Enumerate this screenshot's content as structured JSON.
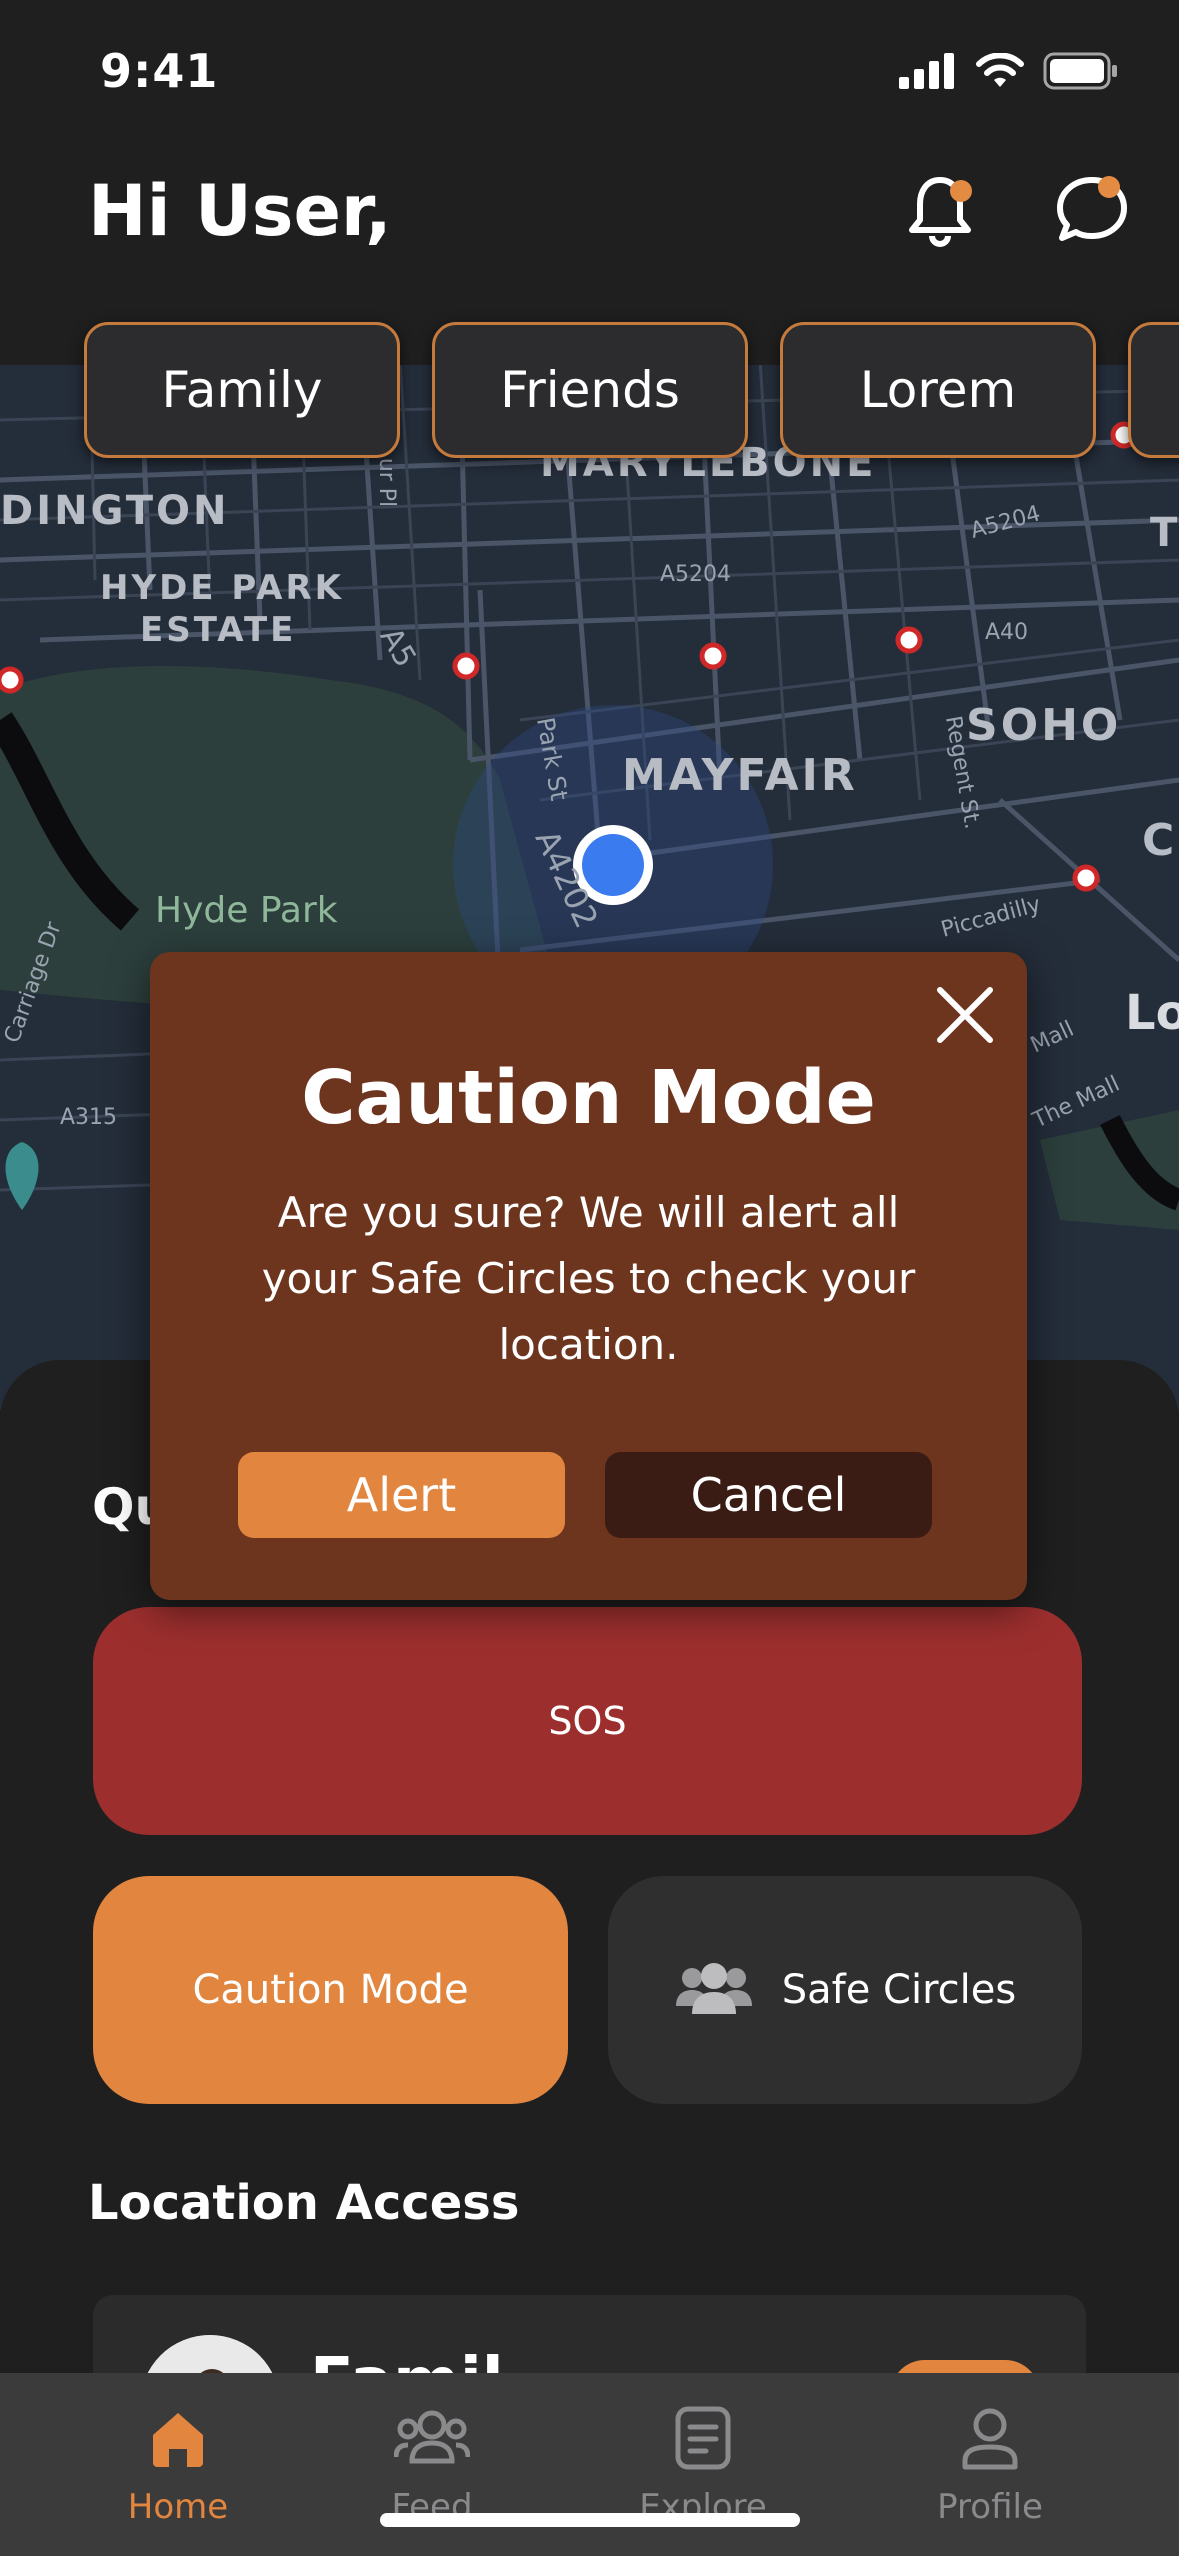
{
  "status_bar": {
    "time": "9:41"
  },
  "header": {
    "greeting": "Hi User,"
  },
  "chips": [
    "Family",
    "Friends",
    "Lorem"
  ],
  "map": {
    "labels": {
      "marylebone": "MARYLEBONE",
      "dington": "DINGTON",
      "hyde_park_estate_1": "HYDE PARK",
      "hyde_park_estate_2": "ESTATE",
      "mayfair": "MAYFAIR",
      "soho": "SOHO",
      "hyde_park": "Hyde Park",
      "a5204_1": "A5204",
      "a5204_2": "A5204",
      "a40": "A40",
      "a5": "A5",
      "park_st": "Park St",
      "a4202": "A4202",
      "regent_st": "Regent St.",
      "piccadilly": "Piccadilly",
      "carriage_dr": "Carriage Dr",
      "a315": "A315",
      "the_mall": "The Mall",
      "mall": "Mall",
      "lo": "Lo",
      "c": "C",
      "t": "T",
      "pl": "ur Pl"
    }
  },
  "quick_actions": {
    "title": "Qu",
    "sos_label": "SOS",
    "caution_label": "Caution Mode",
    "circles_label": "Safe Circles"
  },
  "location_access": {
    "title": "Location Access",
    "card_title": "Famil"
  },
  "tabs": [
    {
      "label": "Home"
    },
    {
      "label": "Feed"
    },
    {
      "label": "Explore"
    },
    {
      "label": "Profile"
    }
  ],
  "modal": {
    "title": "Caution Mode",
    "body": "Are you sure? We will alert all your Safe Circles to check your location.",
    "alert_label": "Alert",
    "cancel_label": "Cancel"
  },
  "colors": {
    "accent": "#e1853f",
    "sos": "#9c2f2e",
    "modal_bg": "#6d351e",
    "cancel_bg": "#3a1c14",
    "location_dot": "#3a7bf0"
  }
}
